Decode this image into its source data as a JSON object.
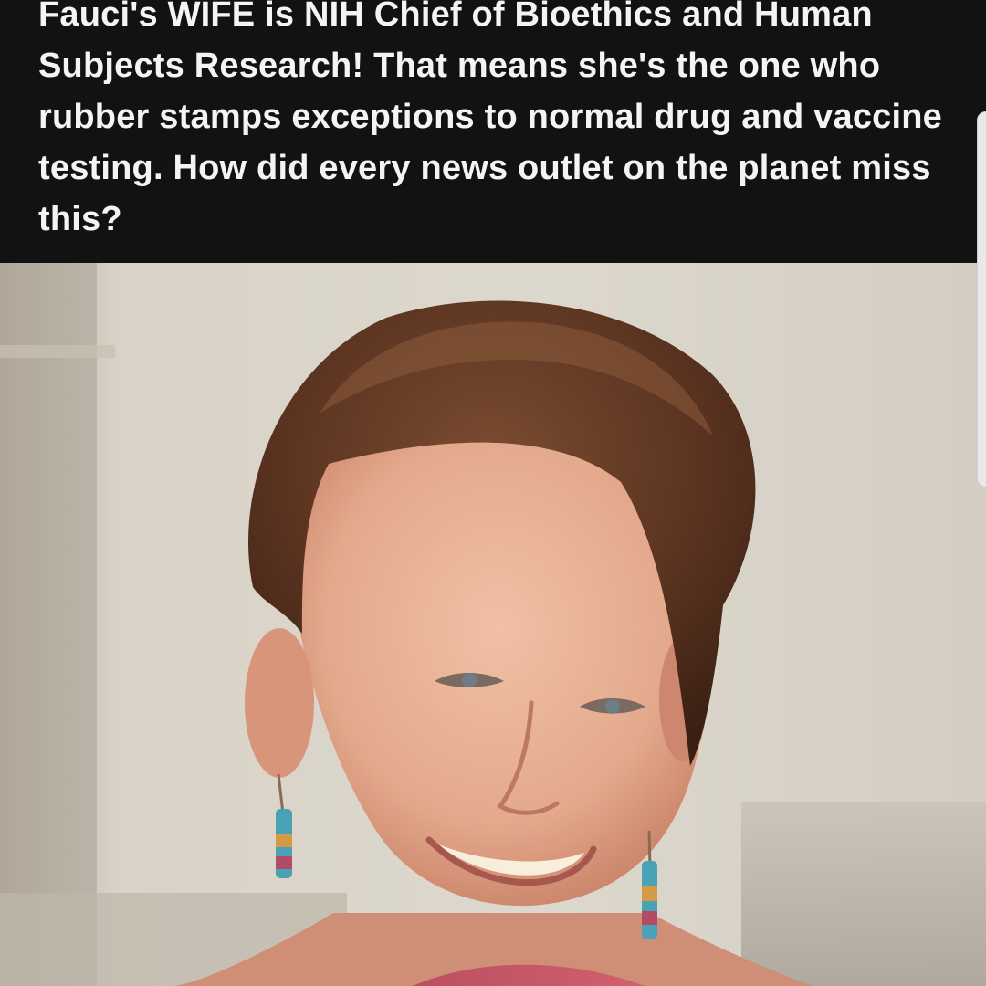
{
  "post": {
    "caption": "Fauci's WIFE is NIH Chief of Bioethics and Human Subjects Research! That means she's the one who rubber stamps exceptions to normal drug and vaccine testing. How did every news outlet on the planet miss this?"
  },
  "colors": {
    "caption_background": "#121212",
    "caption_text": "#f4f4f4",
    "photo_background": "#d7d1c5"
  }
}
